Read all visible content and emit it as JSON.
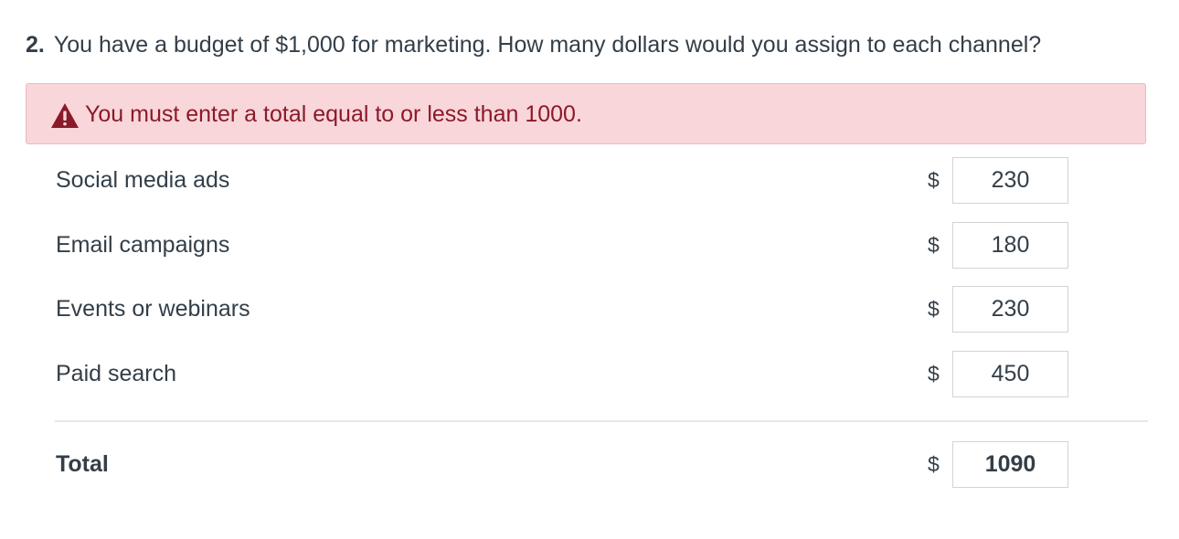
{
  "question": {
    "number": "2.",
    "text": "You have a budget of $1,000 for marketing. How many dollars would you assign to each channel?"
  },
  "error": {
    "icon": "warning-triangle-icon",
    "message": "You must enter a total equal to or less than 1000.",
    "color": "#8a1a2a",
    "background": "#f9d6da"
  },
  "currency_symbol": "$",
  "items": [
    {
      "label": "Social media ads",
      "value": "230"
    },
    {
      "label": "Email campaigns",
      "value": "180"
    },
    {
      "label": "Events or webinars",
      "value": "230"
    },
    {
      "label": "Paid search",
      "value": "450"
    }
  ],
  "total": {
    "label": "Total",
    "value": "1090"
  }
}
